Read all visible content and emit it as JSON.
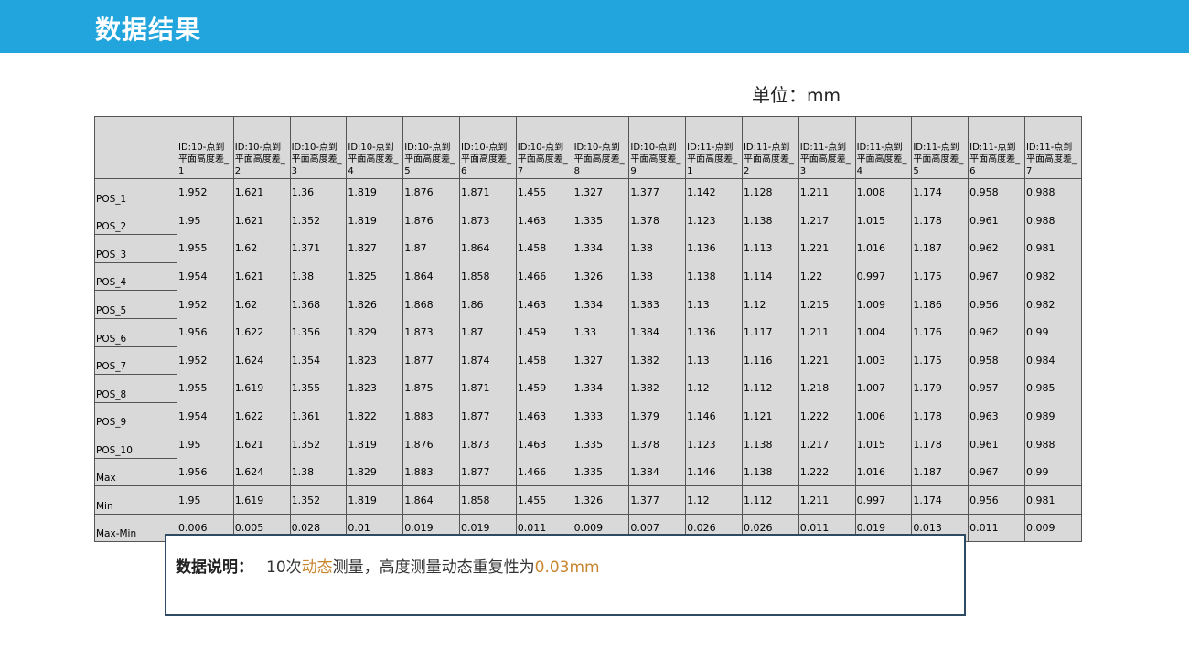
{
  "header": {
    "title": "数据结果"
  },
  "unit": {
    "label": "单位：",
    "value": "mm"
  },
  "table": {
    "columns": [
      "ID:10-点到平面高度差_1",
      "ID:10-点到平面高度差_2",
      "ID:10-点到平面高度差_3",
      "ID:10-点到平面高度差_4",
      "ID:10-点到平面高度差_5",
      "ID:10-点到平面高度差_6",
      "ID:10-点到平面高度差_7",
      "ID:10-点到平面高度差_8",
      "ID:10-点到平面高度差_9",
      "ID:11-点到平面高度差_1",
      "ID:11-点到平面高度差_2",
      "ID:11-点到平面高度差_3",
      "ID:11-点到平面高度差_4",
      "ID:11-点到平面高度差_5",
      "ID:11-点到平面高度差_6",
      "ID:11-点到平面高度差_7"
    ],
    "rows": [
      {
        "label": "POS_1",
        "values": [
          "1.952",
          "1.621",
          "1.36",
          "1.819",
          "1.876",
          "1.871",
          "1.455",
          "1.327",
          "1.377",
          "1.142",
          "1.128",
          "1.211",
          "1.008",
          "1.174",
          "0.958",
          "0.988"
        ]
      },
      {
        "label": "POS_2",
        "values": [
          "1.95",
          "1.621",
          "1.352",
          "1.819",
          "1.876",
          "1.873",
          "1.463",
          "1.335",
          "1.378",
          "1.123",
          "1.138",
          "1.217",
          "1.015",
          "1.178",
          "0.961",
          "0.988"
        ]
      },
      {
        "label": "POS_3",
        "values": [
          "1.955",
          "1.62",
          "1.371",
          "1.827",
          "1.87",
          "1.864",
          "1.458",
          "1.334",
          "1.38",
          "1.136",
          "1.113",
          "1.221",
          "1.016",
          "1.187",
          "0.962",
          "0.981"
        ]
      },
      {
        "label": "POS_4",
        "values": [
          "1.954",
          "1.621",
          "1.38",
          "1.825",
          "1.864",
          "1.858",
          "1.466",
          "1.326",
          "1.38",
          "1.138",
          "1.114",
          "1.22",
          "0.997",
          "1.175",
          "0.967",
          "0.982"
        ]
      },
      {
        "label": "POS_5",
        "values": [
          "1.952",
          "1.62",
          "1.368",
          "1.826",
          "1.868",
          "1.86",
          "1.463",
          "1.334",
          "1.383",
          "1.13",
          "1.12",
          "1.215",
          "1.009",
          "1.186",
          "0.956",
          "0.982"
        ]
      },
      {
        "label": "POS_6",
        "values": [
          "1.956",
          "1.622",
          "1.356",
          "1.829",
          "1.873",
          "1.87",
          "1.459",
          "1.33",
          "1.384",
          "1.136",
          "1.117",
          "1.211",
          "1.004",
          "1.176",
          "0.962",
          "0.99"
        ]
      },
      {
        "label": "POS_7",
        "values": [
          "1.952",
          "1.624",
          "1.354",
          "1.823",
          "1.877",
          "1.874",
          "1.458",
          "1.327",
          "1.382",
          "1.13",
          "1.116",
          "1.221",
          "1.003",
          "1.175",
          "0.958",
          "0.984"
        ]
      },
      {
        "label": "POS_8",
        "values": [
          "1.955",
          "1.619",
          "1.355",
          "1.823",
          "1.875",
          "1.871",
          "1.459",
          "1.334",
          "1.382",
          "1.12",
          "1.112",
          "1.218",
          "1.007",
          "1.179",
          "0.957",
          "0.985"
        ]
      },
      {
        "label": "POS_9",
        "values": [
          "1.954",
          "1.622",
          "1.361",
          "1.822",
          "1.883",
          "1.877",
          "1.463",
          "1.333",
          "1.379",
          "1.146",
          "1.121",
          "1.222",
          "1.006",
          "1.178",
          "0.963",
          "0.989"
        ]
      },
      {
        "label": "POS_10",
        "values": [
          "1.95",
          "1.621",
          "1.352",
          "1.819",
          "1.876",
          "1.873",
          "1.463",
          "1.335",
          "1.378",
          "1.123",
          "1.138",
          "1.217",
          "1.015",
          "1.178",
          "0.961",
          "0.988"
        ]
      }
    ],
    "stats": [
      {
        "label": "Max",
        "values": [
          "1.956",
          "1.624",
          "1.38",
          "1.829",
          "1.883",
          "1.877",
          "1.466",
          "1.335",
          "1.384",
          "1.146",
          "1.138",
          "1.222",
          "1.016",
          "1.187",
          "0.967",
          "0.99"
        ]
      },
      {
        "label": "Min",
        "values": [
          "1.95",
          "1.619",
          "1.352",
          "1.819",
          "1.864",
          "1.858",
          "1.455",
          "1.326",
          "1.377",
          "1.12",
          "1.112",
          "1.211",
          "0.997",
          "1.174",
          "0.956",
          "0.981"
        ]
      },
      {
        "label": "Max-Min",
        "values": [
          "0.006",
          "0.005",
          "0.028",
          "0.01",
          "0.019",
          "0.019",
          "0.011",
          "0.009",
          "0.007",
          "0.026",
          "0.026",
          "0.011",
          "0.019",
          "0.013",
          "0.011",
          "0.009"
        ]
      }
    ]
  },
  "note": {
    "label": "数据说明：",
    "part1": "10次",
    "highlight1": "动态",
    "part2": "测量，高度测量动态重复性为",
    "highlight2": "0.03mm"
  },
  "colors": {
    "header": "#22a4dd",
    "table_bg": "#d9d9d9",
    "highlight": "#c9862f",
    "note_border": "#2f4a63"
  }
}
